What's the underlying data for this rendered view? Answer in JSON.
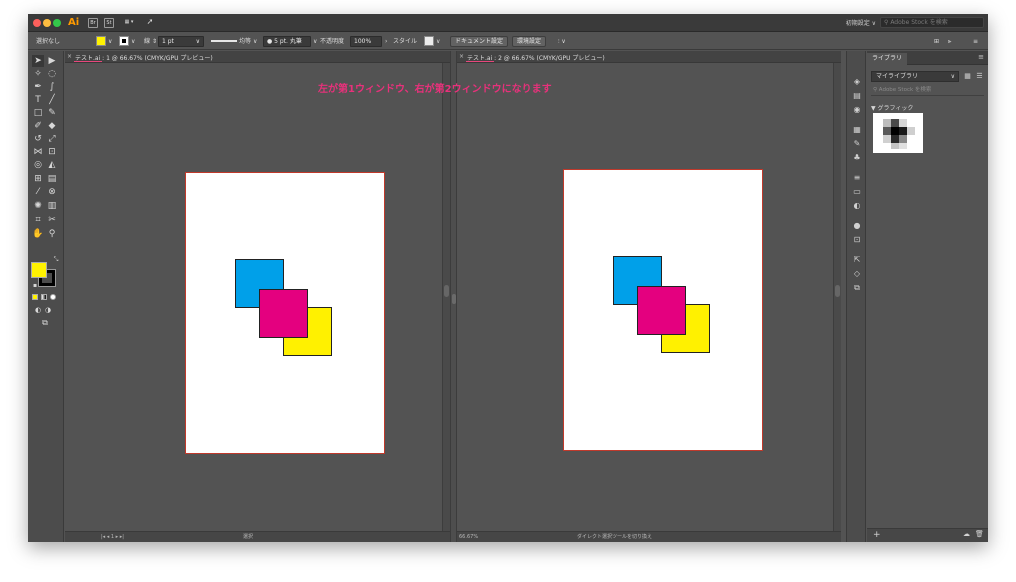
{
  "titlebar": {
    "app_name": "Ai",
    "bridge_icon": "Br",
    "stock_icon": "St",
    "workspace": "初期設定 ∨",
    "stock_search_placeholder": "Adobe Stock を検索"
  },
  "controlbar": {
    "selection_status": "選択なし",
    "stroke_label": "線",
    "stroke_weight": "1 pt",
    "profile": "均等",
    "brush": "5 pt. 丸筆",
    "opacity_label": "不透明度",
    "opacity_value": "100%",
    "style_label": "スタイル",
    "document_setup_button": "ドキュメント設定",
    "preferences_button": "環境設定"
  },
  "colors": {
    "fill": "#fff200",
    "stroke": "#000000",
    "cyan": "#00a0e9",
    "magenta": "#e4007f",
    "yellow": "#fff100",
    "annotation": "#e8317b"
  },
  "documents": [
    {
      "tab_label": "テスト.ai : 1 @ 66.67% (CMYK/GPU プレビュー)",
      "status_tool": "選択",
      "status_zoom": "66.67%"
    },
    {
      "tab_label": "テスト.ai : 2 @ 66.67% (CMYK/GPU プレビュー)",
      "status_tool": "ダイレクト選択ツールを切り換え",
      "status_zoom": "66.67%"
    }
  ],
  "annotation_text": "左が第1ウィンドウ、右が第2ウィンドウになります",
  "library": {
    "tab_label": "ライブラリ",
    "library_name": "マイライブラリ",
    "search_placeholder": "Adobe Stock を検索",
    "section_title": "▼ グラフィック"
  }
}
